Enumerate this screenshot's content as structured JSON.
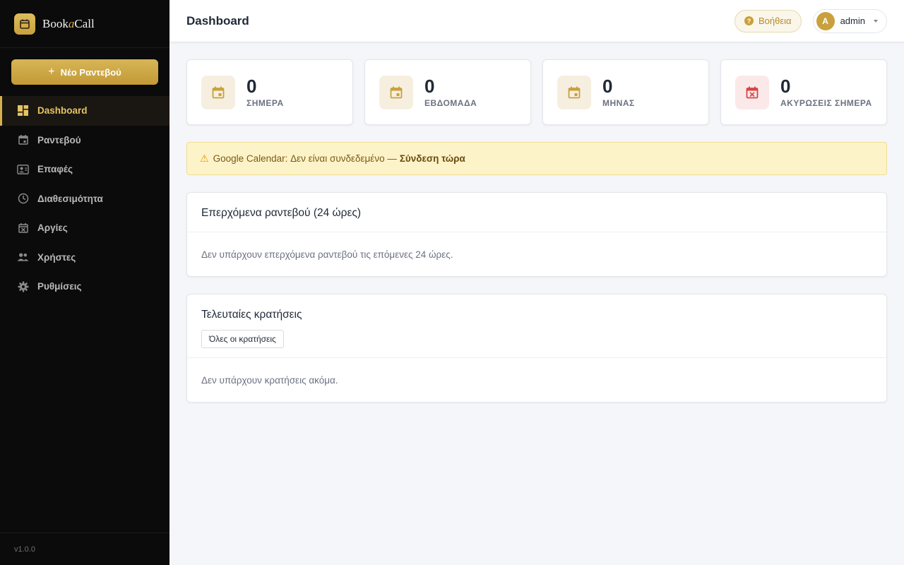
{
  "brand": {
    "name_prefix": "Book",
    "name_accent": "a",
    "name_suffix": "Call"
  },
  "sidebar": {
    "new_button_label": "Νέο Ραντεβού",
    "items": [
      {
        "label": "Dashboard",
        "icon": "dashboard-icon",
        "active": true
      },
      {
        "label": "Ραντεβού",
        "icon": "calendar-icon",
        "active": false
      },
      {
        "label": "Επαφές",
        "icon": "contacts-icon",
        "active": false
      },
      {
        "label": "Διαθεσιμότητα",
        "icon": "clock-icon",
        "active": false
      },
      {
        "label": "Αργίες",
        "icon": "calendar-x-icon",
        "active": false
      },
      {
        "label": "Χρήστες",
        "icon": "users-icon",
        "active": false
      },
      {
        "label": "Ρυθμίσεις",
        "icon": "gear-icon",
        "active": false
      }
    ],
    "version": "v1.0.0"
  },
  "header": {
    "title": "Dashboard",
    "help_label": "Βοήθεια",
    "user_initial": "A",
    "user_name": "admin"
  },
  "stats": [
    {
      "value": "0",
      "label": "ΣΗΜΕΡΑ",
      "icon": "calendar-icon"
    },
    {
      "value": "0",
      "label": "ΕΒΔΟΜΑΔΑ",
      "icon": "calendar-icon"
    },
    {
      "value": "0",
      "label": "ΜΗΝΑΣ",
      "icon": "calendar-icon"
    },
    {
      "value": "0",
      "label": "ΑΚΥΡΩΣΕΙΣ ΣΗΜΕΡΑ",
      "icon": "calendar-x-icon"
    }
  ],
  "alert": {
    "text": "Google Calendar: Δεν είναι συνδεδεμένο —",
    "link_label": "Σύνδεση τώρα"
  },
  "upcoming": {
    "title": "Επερχόμενα ραντεβού (24 ώρες)",
    "empty_text": "Δεν υπάρχουν επερχόμενα ραντεβού τις επόμενες 24 ώρες."
  },
  "recent": {
    "title": "Τελευταίες κρατήσεις",
    "button_label": "Όλες οι κρατήσεις",
    "empty_text": "Δεν υπάρχουν κρατήσεις ακόμα."
  },
  "colors": {
    "accent": "#c9a13c",
    "sidebar_bg": "#0b0b0b",
    "alert_bg": "#fdf3c8",
    "danger": "#d64545"
  }
}
